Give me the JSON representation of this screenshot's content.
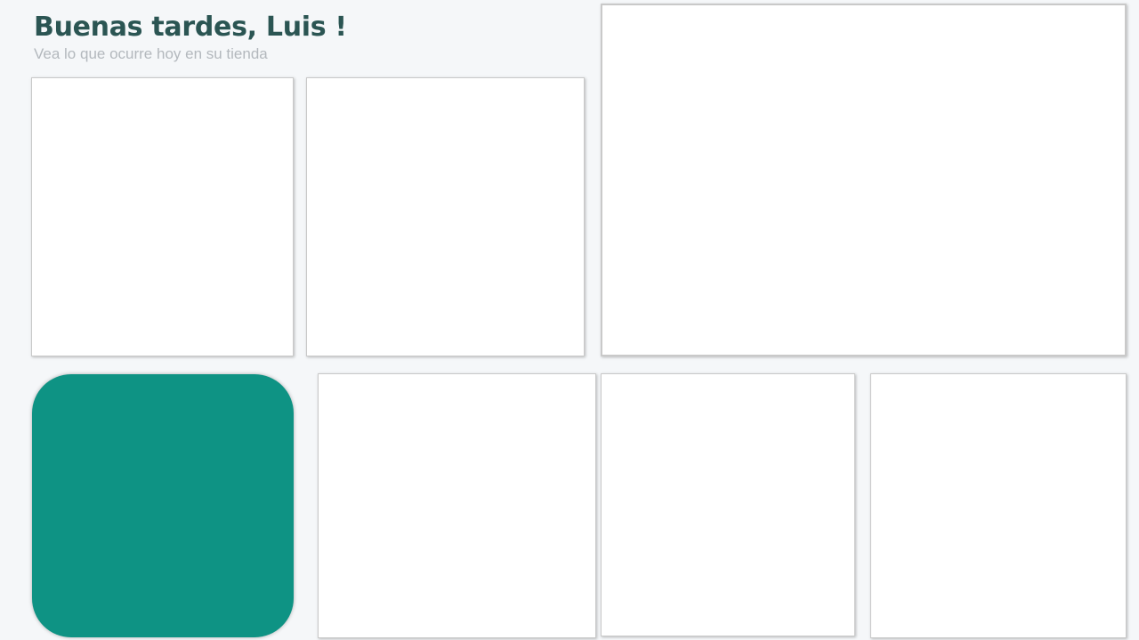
{
  "header": {
    "greeting": "Buenas tardes, Luis !",
    "subtitle": "Vea lo que ocurre hoy en su tienda"
  },
  "colors": {
    "accent_teal": "#0e9384",
    "greeting_text": "#2b5553",
    "subtitle_text": "#b3b8bd",
    "background": "#f5f7f9"
  }
}
